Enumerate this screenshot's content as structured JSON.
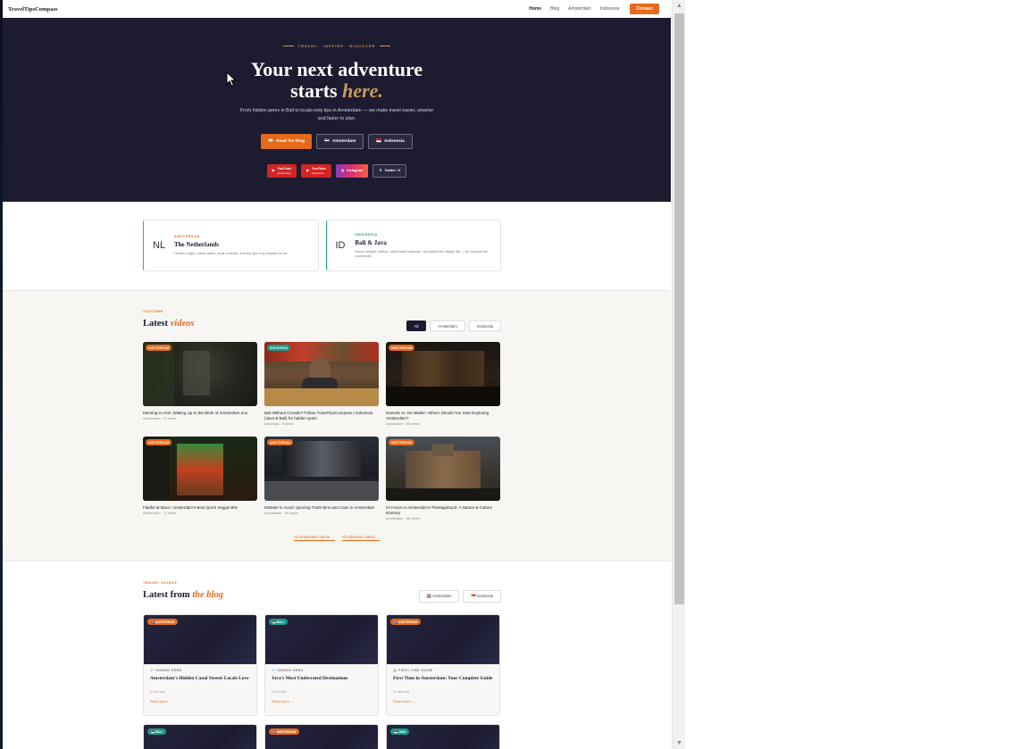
{
  "nav": {
    "brand": "TravelTipsCompass",
    "links": [
      "Home",
      "Blog",
      "Amsterdam",
      "Indonesia"
    ],
    "contact": "Contact"
  },
  "hero": {
    "eyebrow": "TRAVEL · INSPIRE · DISCOVER",
    "title_line1": "Your next adventure",
    "title_line2a": "starts ",
    "title_line2b": "here.",
    "subtitle": "From hidden gems in Bali to locals-only tips in Amsterdam — we make travel easier, smarter and faster to plan.",
    "cta": [
      {
        "icon": "📖",
        "label": "Read the blog"
      },
      {
        "icon": "🇳🇱",
        "label": "Amsterdam"
      },
      {
        "icon": "🇮🇩",
        "label": "Indonesia"
      }
    ],
    "social": [
      {
        "label": "YouTube",
        "sub": "Amsterdam"
      },
      {
        "label": "YouTube",
        "sub": "Indonesia"
      },
      {
        "label": "Instagram",
        "sub": ""
      },
      {
        "label": "Twitter / X",
        "sub": ""
      }
    ]
  },
  "destinations": [
    {
      "code": "NL",
      "tag": "AMSTERDAM",
      "name": "The Netherlands",
      "desc": "Hidden hofjes, canal walks, local markets, and the tips only insiders know."
    },
    {
      "code": "ID",
      "tag": "INDONESIA",
      "name": "Bali & Java",
      "desc": "Secret temple valleys, black-sand beaches, and authentic village life — far beyond the tourist trail."
    }
  ],
  "videos": {
    "eyebrow": "YOUTUBE",
    "title": "Latest ",
    "title_em": "videos",
    "filters": [
      "All",
      "Amsterdam",
      "Indonesia"
    ],
    "items": [
      {
        "badge": "AMSTERDAM",
        "title": "Morning in Artis: Waking Up to the Birds of Amsterdam Zoo",
        "meta": "Amsterdam · 71 views"
      },
      {
        "badge": "INDONESIA",
        "title": "Bali Without Crowds? Follow TravelTipsCompass | Indonesia (Java & Bali) for hidden spots",
        "meta": "Indonesia · 8 views"
      },
      {
        "badge": "AMSTERDAM",
        "title": "Damrak vs. De Wallen: Where Should You Start Exploring Amsterdam?",
        "meta": "Amsterdam · 90 views"
      },
      {
        "badge": "AMSTERDAM",
        "title": "Falafel at Maoz: Amsterdam's Best Quick Veggie Bite",
        "meta": "Amsterdam · 71 views"
      },
      {
        "badge": "AMSTERDAM",
        "title": "Mistake to Avoid: Ignoring Trash Bins and Cans in Amsterdam",
        "meta": "Amsterdam · 90 views"
      },
      {
        "badge": "AMSTERDAM",
        "title": "24 Hours in Amsterdam's Plantagebuurt: A Nature & Culture Itinerary",
        "meta": "Amsterdam · 98 views"
      }
    ],
    "all_links": [
      "All Amsterdam videos →",
      "All Indonesia videos →"
    ]
  },
  "blog": {
    "eyebrow": "TRAVEL GUIDES",
    "title": "Latest from ",
    "title_em": "the blog",
    "filters": [
      "🇳🇱 Amsterdam",
      "🇮🇩 Indonesia"
    ],
    "items": [
      {
        "badge": "🇳🇱 AMSTERDAM",
        "cat": "💎 HIDDEN GEMS",
        "title": "Amsterdam's Hidden Canal Streets Locals Love",
        "read": "8 min read",
        "more": "Read more →"
      },
      {
        "badge": "🇮🇩 BALI",
        "cat": "💎 HIDDEN GEMS",
        "title": "Java's Most Underrated Destinations",
        "read": "9 min read",
        "more": "Read more →"
      },
      {
        "badge": "🇳🇱 AMSTERDAM",
        "cat": "🏠 FIRST-TIME GUIDE",
        "title": "First Time in Amsterdam: Your Complete Guide",
        "read": "11 min read",
        "more": "Read more →"
      },
      {
        "badge": "🇮🇩 BALI"
      },
      {
        "badge": "🇳🇱 AMSTERDAM"
      },
      {
        "badge": "🇮🇩 JAVA"
      }
    ]
  },
  "colors": {
    "accent": "#e56a1a",
    "teal": "#1a9a8a",
    "hero_bg": "#1c1b30",
    "gold": "#c79b5a"
  }
}
